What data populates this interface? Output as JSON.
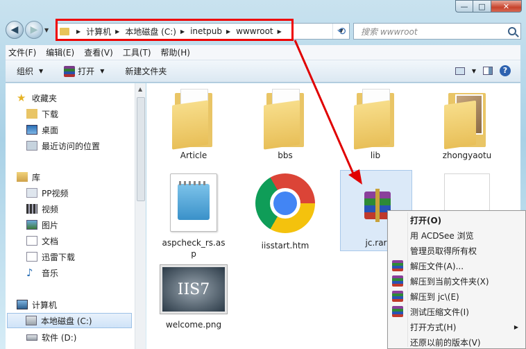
{
  "window": {
    "controls": {
      "minimize": "—",
      "maximize": "□",
      "close": "✕"
    }
  },
  "nav": {
    "back_icon": "back-arrow-icon",
    "forward_icon": "forward-arrow-icon",
    "back_glyph": "◀",
    "forward_glyph": "▶",
    "history_glyph": "▼"
  },
  "address": {
    "crumbs": [
      "计算机",
      "本地磁盘 (C:)",
      "inetpub",
      "wwwroot"
    ],
    "dropdown_glyph": "▼",
    "refresh_glyph": "⟲"
  },
  "search": {
    "placeholder": "搜索 wwwroot"
  },
  "menubar": {
    "items": [
      "文件(F)",
      "编辑(E)",
      "查看(V)",
      "工具(T)",
      "帮助(H)"
    ]
  },
  "cmdbar": {
    "organize": "组织",
    "open": "打开",
    "new_folder": "新建文件夹",
    "caret": "▼",
    "help": "?"
  },
  "navpane": {
    "favorites": "收藏夹",
    "downloads": "下载",
    "desktop": "桌面",
    "recent": "最近访问的位置",
    "libraries": "库",
    "pp_video": "PP视频",
    "video": "视频",
    "pictures": "图片",
    "documents": "文档",
    "xunlei": "迅雷下载",
    "music": "音乐",
    "computer": "计算机",
    "local_c": "本地磁盘 (C:)",
    "soft_d": "软件 (D:)",
    "scroll_up": "▲"
  },
  "files": [
    {
      "name": "Article",
      "type": "folder"
    },
    {
      "name": "bbs",
      "type": "folder"
    },
    {
      "name": "lib",
      "type": "folder"
    },
    {
      "name": "zhongyaotu",
      "type": "folder"
    },
    {
      "name": "aspcheck_rs.asp",
      "type": "asp"
    },
    {
      "name": "iisstart.htm",
      "type": "htm"
    },
    {
      "name": "jc.rar",
      "type": "rar"
    },
    {
      "name": "",
      "type": "blank"
    },
    {
      "name": "welcome.png",
      "type": "png"
    }
  ],
  "iis_logo_text": "IIS7",
  "context_menu": {
    "items": [
      {
        "label": "打开(O)",
        "bold": true,
        "icon": false
      },
      {
        "label": "用 ACDSee 浏览",
        "icon": false
      },
      {
        "label": "管理员取得所有权",
        "icon": false
      },
      {
        "label": "解压文件(A)...",
        "icon": true
      },
      {
        "label": "解压到当前文件夹(X)",
        "icon": true
      },
      {
        "label": "解压到 jc\\(E)",
        "icon": true
      },
      {
        "label": "测试压缩文件(I)",
        "icon": true
      },
      {
        "label": "打开方式(H)",
        "icon": false,
        "submenu": true
      },
      {
        "label": "还原以前的版本(V)",
        "icon": false
      }
    ],
    "submenu_glyph": "▶"
  },
  "colors": {
    "highlight": "#e00000",
    "arrow": "#e00000"
  }
}
